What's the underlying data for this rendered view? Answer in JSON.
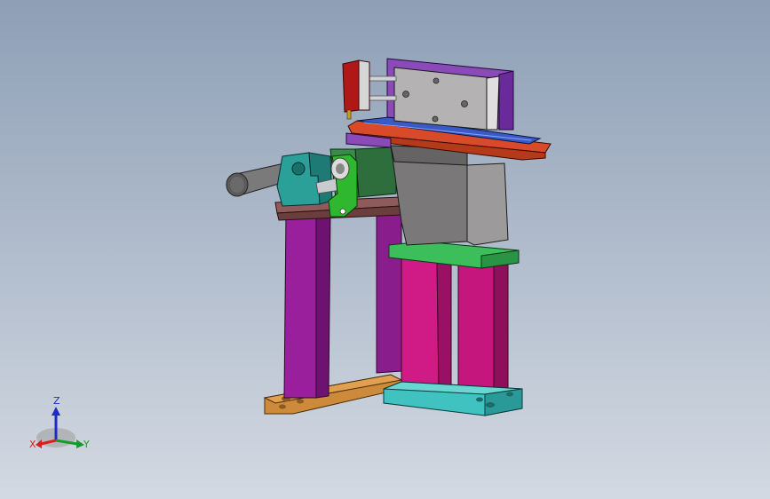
{
  "viewport": {
    "background_top": "#8e9fb6",
    "background_bottom": "#d3d9e2"
  },
  "triad": {
    "x_label": "X",
    "y_label": "Y",
    "z_label": "Z",
    "x_color": "#d62020",
    "y_color": "#1a9a2a",
    "z_color": "#1d2bc8"
  }
}
